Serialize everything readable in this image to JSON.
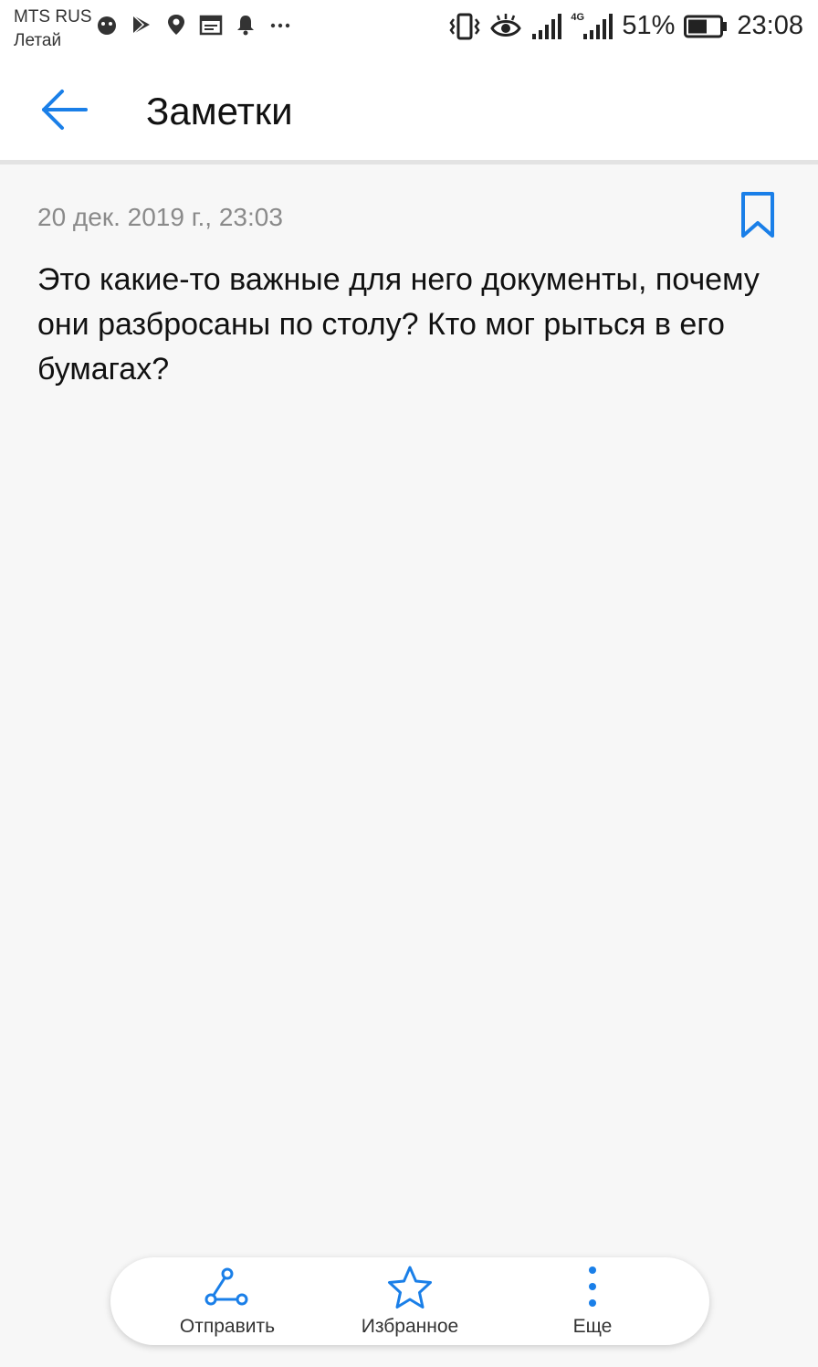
{
  "status_bar": {
    "carrier": "MTS RUS",
    "carrier_sub": "Летай",
    "left_icons": [
      "android-icon",
      "play-store-icon",
      "location-icon",
      "calendar-icon",
      "notification-bell-icon",
      "more-dots-icon"
    ],
    "right_icons": [
      "vibrate-icon",
      "eye-comfort-icon",
      "signal-icon",
      "4g-signal-icon",
      "battery-icon"
    ],
    "network": "4G",
    "battery": "51%",
    "time": "23:08"
  },
  "header": {
    "title": "Заметки",
    "back_icon": "arrow-left-icon"
  },
  "note": {
    "date": "20 дек. 2019 г., 23:03",
    "body": "Это какие-то важные для него документы, почему они разбросаны по столу? Кто мог рыться в его бумагах?",
    "bookmark_icon": "bookmark-icon"
  },
  "toolbar": {
    "share_label": "Отправить",
    "favorite_label": "Избранное",
    "more_label": "Еще"
  },
  "colors": {
    "accent": "#1a7fe8",
    "background": "#f7f7f7",
    "surface": "#ffffff",
    "date_text": "#8a8a8a"
  }
}
